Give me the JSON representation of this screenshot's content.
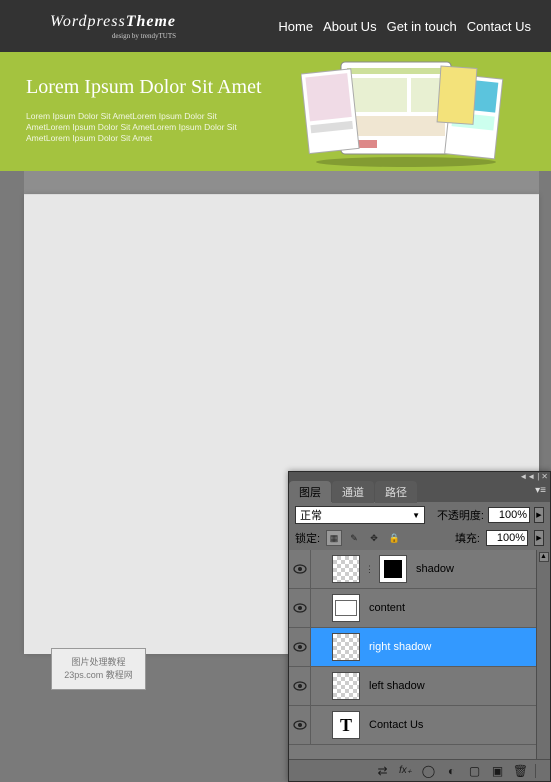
{
  "header": {
    "logo_main_1": "Wordpress",
    "logo_main_2": "Theme",
    "logo_sub": "design by trendyTUTS",
    "nav": [
      "Home",
      "About Us",
      "Get in touch",
      "Contact Us"
    ]
  },
  "hero": {
    "title": "Lorem Ipsum Dolor Sit Amet",
    "line1": "Lorem Ipsum Dolor Sit AmetLorem Ipsum Dolor Sit",
    "line2": "AmetLorem Ipsum Dolor Sit AmetLorem Ipsum Dolor Sit",
    "line3": "AmetLorem Ipsum Dolor Sit Amet"
  },
  "watermark": {
    "line1": "图片处理教程",
    "line2": "23ps.com 教程网"
  },
  "panel": {
    "top": {
      "collapse": "◄◄",
      "divider": "|",
      "close": "✕"
    },
    "tabs": {
      "layers": "图层",
      "channels": "通道",
      "paths": "路径",
      "menu": "▾≡"
    },
    "blend_mode": "正常",
    "blend_arrow": "▼",
    "opacity_label": "不透明度:",
    "opacity_value": "100%",
    "lock_label": "锁定:",
    "fill_label": "填充:",
    "fill_value": "100%",
    "arrow_glyph": "▶",
    "scroll_up": "▲",
    "lock_icons": {
      "transparency": "▦",
      "brush": "✎",
      "move": "✥",
      "all": "🔒"
    },
    "layers": [
      {
        "name": "shadow",
        "visible": true,
        "selected": false,
        "type": "shadow",
        "linked": true
      },
      {
        "name": "content",
        "visible": true,
        "selected": false,
        "type": "content"
      },
      {
        "name": "right shadow",
        "visible": true,
        "selected": true,
        "type": "shadow-side"
      },
      {
        "name": "left shadow",
        "visible": true,
        "selected": false,
        "type": "shadow-side"
      },
      {
        "name": "Contact Us",
        "visible": true,
        "selected": false,
        "type": "text"
      }
    ],
    "type_glyph": "T",
    "link_glyph": "⋮",
    "footer_icons": {
      "link": "⇄",
      "fx": "fx₊",
      "mask": "◯",
      "adjust": "◐",
      "folder": "▢",
      "new": "▣",
      "trash": "🗑"
    }
  }
}
